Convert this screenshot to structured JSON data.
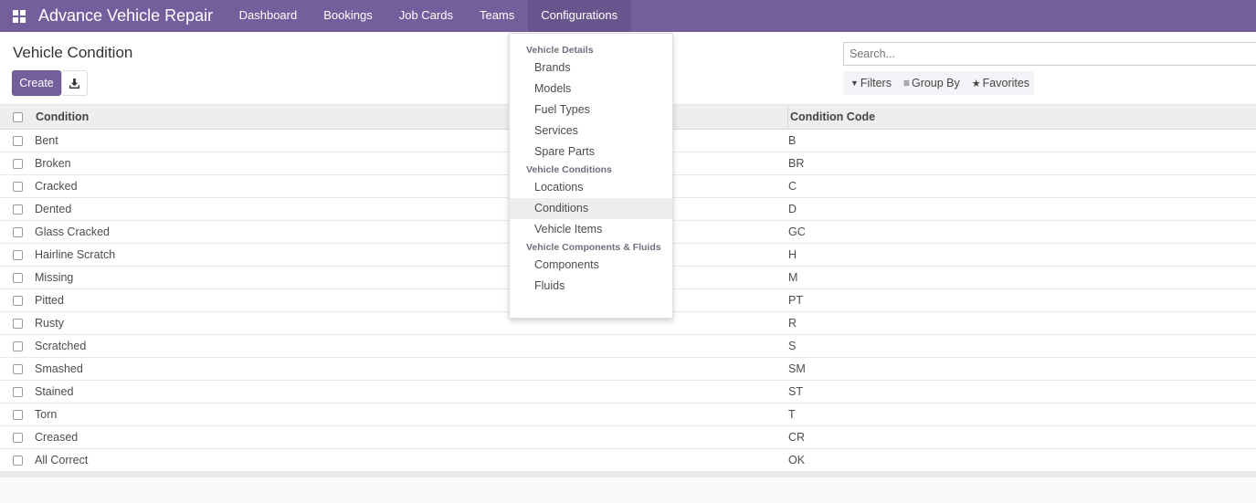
{
  "navbar": {
    "app_title": "Advance Vehicle Repair",
    "menu": [
      "Dashboard",
      "Bookings",
      "Job Cards",
      "Teams",
      "Configurations"
    ],
    "active_menu": "Configurations",
    "color": "#745e9c"
  },
  "control_panel": {
    "title": "Vehicle Condition",
    "create_label": "Create",
    "download_icon": "download-icon",
    "search_placeholder": "Search...",
    "filters_label": "Filters",
    "group_by_label": "Group By",
    "favorites_label": "Favorites"
  },
  "list": {
    "columns": [
      "Condition",
      "Condition Code"
    ],
    "rows": [
      {
        "name": "Bent",
        "code": "B"
      },
      {
        "name": "Broken",
        "code": "BR"
      },
      {
        "name": "Cracked",
        "code": "C"
      },
      {
        "name": "Dented",
        "code": "D"
      },
      {
        "name": "Glass Cracked",
        "code": "GC"
      },
      {
        "name": "Hairline Scratch",
        "code": "H"
      },
      {
        "name": "Missing",
        "code": "M"
      },
      {
        "name": "Pitted",
        "code": "PT"
      },
      {
        "name": "Rusty",
        "code": "R"
      },
      {
        "name": "Scratched",
        "code": "S"
      },
      {
        "name": "Smashed",
        "code": "SM"
      },
      {
        "name": "Stained",
        "code": "ST"
      },
      {
        "name": "Torn",
        "code": "T"
      },
      {
        "name": "Creased",
        "code": "CR"
      },
      {
        "name": "All Correct",
        "code": "OK"
      }
    ]
  },
  "dropdown": {
    "sections": [
      {
        "header": "Vehicle Details",
        "items": [
          "Brands",
          "Models",
          "Fuel Types",
          "Services",
          "Spare Parts"
        ]
      },
      {
        "header": "Vehicle Conditions",
        "items": [
          "Locations",
          "Conditions",
          "Vehicle Items"
        ]
      },
      {
        "header": "Vehicle Components & Fluids",
        "items": [
          "Components",
          "Fluids"
        ]
      }
    ],
    "active_item": "Conditions"
  }
}
